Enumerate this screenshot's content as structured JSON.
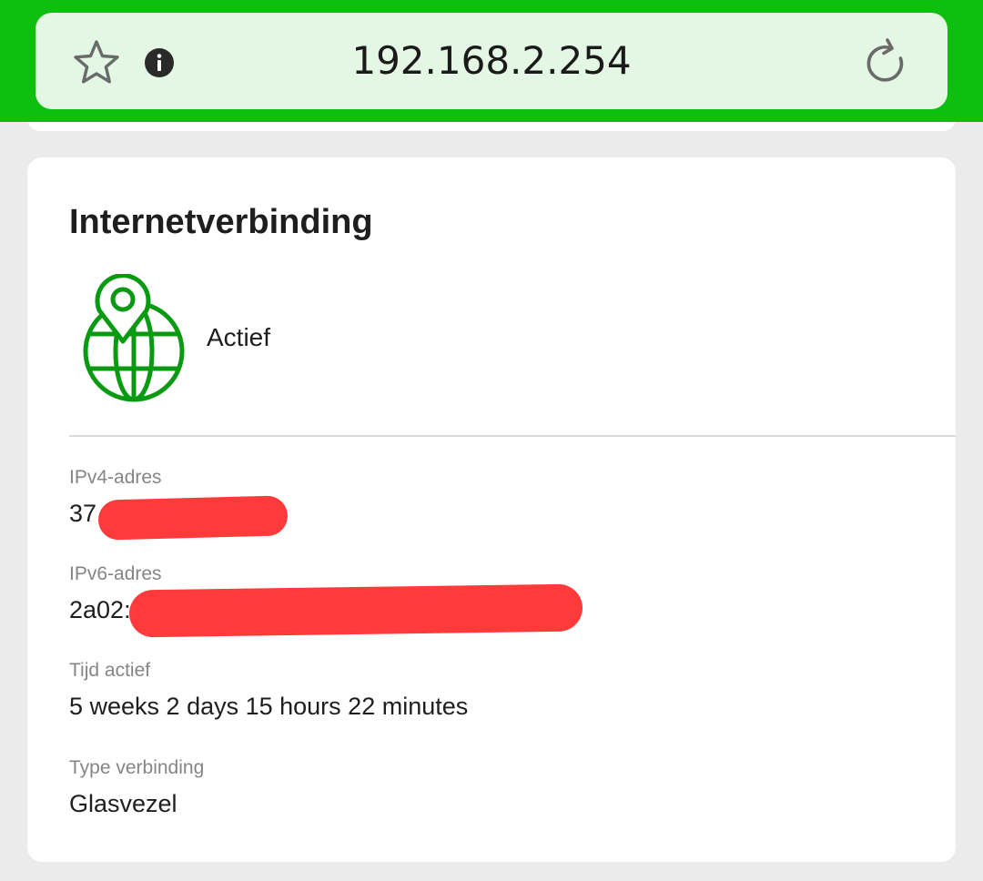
{
  "browser": {
    "url": "192.168.2.254",
    "star_icon": "star-outline-icon",
    "info_icon": "info-icon",
    "reload_icon": "reload-icon",
    "accent_color": "#0ebf10"
  },
  "card": {
    "title": "Internetverbinding",
    "status_icon": "globe-location-pin-icon",
    "status_color": "#0a9a12",
    "status": "Actief",
    "fields": [
      {
        "label": "IPv4-adres",
        "value": "37.",
        "redacted": true
      },
      {
        "label": "IPv6-adres",
        "value": "2a02:",
        "redacted": true
      },
      {
        "label": "Tijd actief",
        "value": "5 weeks 2 days 15 hours 22 minutes"
      },
      {
        "label": "Type verbinding",
        "value": "Glasvezel"
      }
    ]
  }
}
